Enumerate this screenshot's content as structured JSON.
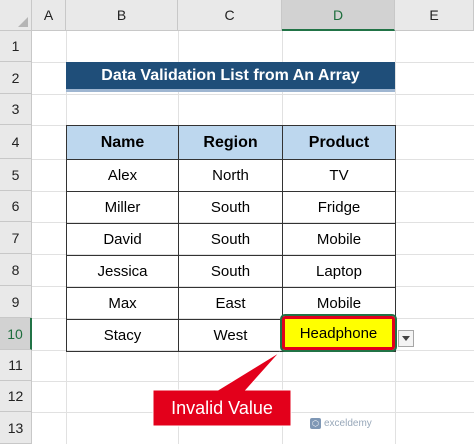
{
  "spreadsheet": {
    "columns": [
      "A",
      "B",
      "C",
      "D",
      "E"
    ],
    "rows": [
      "1",
      "2",
      "3",
      "4",
      "5",
      "6",
      "7",
      "8",
      "9",
      "10",
      "11",
      "12",
      "13"
    ],
    "selected_column": "D",
    "selected_row": "10"
  },
  "title": "Data Validation List from An Array",
  "table": {
    "headers": [
      "Name",
      "Region",
      "Product"
    ],
    "rows": [
      [
        "Alex",
        "North",
        "TV"
      ],
      [
        "Miller",
        "South",
        "Fridge"
      ],
      [
        "David",
        "South",
        "Mobile"
      ],
      [
        "Jessica",
        "South",
        "Laptop"
      ],
      [
        "Max",
        "East",
        "Mobile"
      ],
      [
        "Stacy",
        "West",
        ""
      ]
    ]
  },
  "active_cell": {
    "value": "Headphone",
    "fill_color": "#ffff00",
    "border_color": "#e3001b"
  },
  "callout": {
    "text": "Invalid Value",
    "color": "#e3001b"
  },
  "watermark": {
    "brand": "exceldemy",
    "tagline": "EXCEL · DATA · BI"
  },
  "icons": {
    "dropdown": "chevron-down-icon"
  }
}
